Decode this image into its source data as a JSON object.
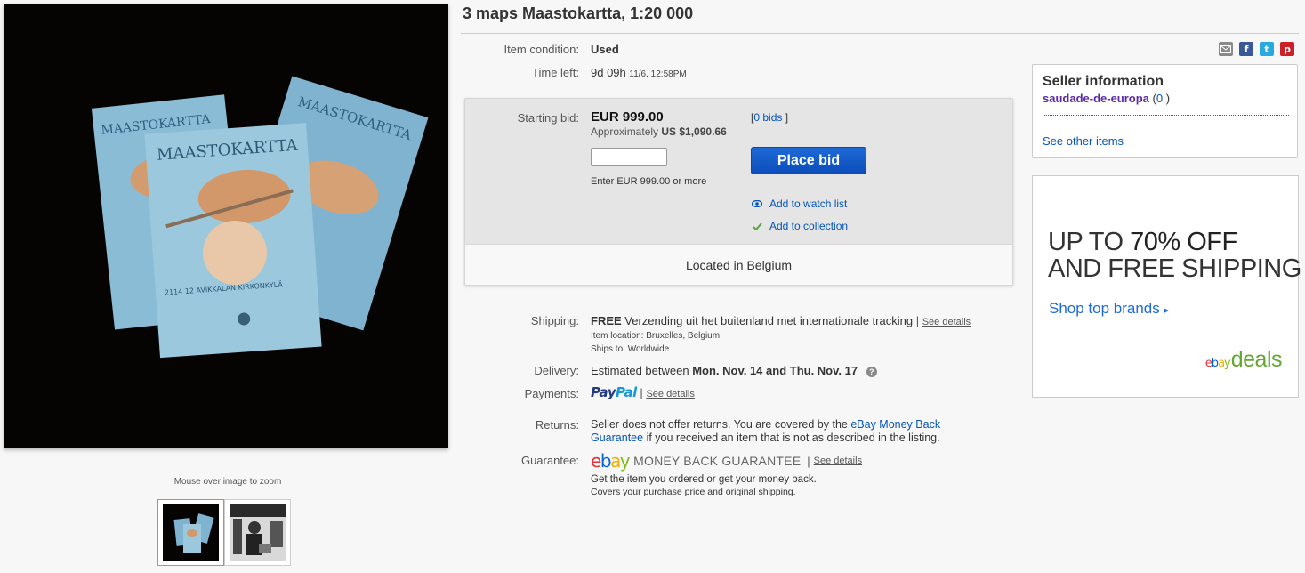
{
  "listing": {
    "title": "3 maps Maastokartta, 1:20 000"
  },
  "gallery": {
    "zoom_hint": "Mouse over image to zoom",
    "map_cover_title": "MAASTOKARTTA",
    "map_cover_footer": "2114 12 AVIKKALAN KIRKONKYLÄ"
  },
  "share": {
    "mail_icon": "mail-icon",
    "facebook_icon": "f",
    "twitter_icon": "t",
    "pinterest_icon": "p"
  },
  "details": {
    "condition_label": "Item condition:",
    "condition_value": "Used",
    "time_left_label": "Time left:",
    "time_left_value": "9d 09h",
    "time_left_end": "11/6, 12:58PM"
  },
  "bid": {
    "starting_bid_label": "Starting bid:",
    "price": "EUR 999.00",
    "approx_label": "Approximately",
    "approx_value": "US $1,090.66",
    "bids_open": "[",
    "bids_link": "0 bids",
    "bids_close": "]",
    "input_hint": "Enter EUR 999.00 or more",
    "place_bid_label": "Place bid",
    "watch_label": "Add to watch list",
    "collection_label": "Add to collection",
    "location": "Located in Belgium"
  },
  "shipping": {
    "label": "Shipping:",
    "free": "FREE",
    "method": "Verzending uit het buitenland met internationale tracking",
    "sep": "|",
    "see_details": "See details",
    "item_location": "Item location:  Bruxelles, Belgium",
    "ships_to": "Ships to:  Worldwide"
  },
  "delivery": {
    "label": "Delivery:",
    "prefix": "Estimated between",
    "dates": "Mon. Nov. 14 and Thu. Nov. 17",
    "help": "?"
  },
  "payments": {
    "label": "Payments:",
    "paypal_a": "Pay",
    "paypal_b": "Pal",
    "sep": "|",
    "see_details": "See details"
  },
  "returns": {
    "label": "Returns:",
    "text_a": "Seller does not offer returns. You are covered by the",
    "link_a": "eBay Money Back",
    "link_b": "Guarantee",
    "text_b": "if you received an item that is not as described in the listing."
  },
  "guarantee": {
    "label": "Guarantee:",
    "logo_e": "e",
    "logo_b": "b",
    "logo_a": "a",
    "logo_y": "y",
    "mbg": "MONEY BACK GUARANTEE",
    "sep": "|",
    "see_details": "See details",
    "line1": "Get the item you ordered or get your money back.",
    "line2": "Covers your purchase price and original shipping."
  },
  "seller": {
    "title": "Seller information",
    "name": "saudade-de-europa",
    "score_open": "(",
    "score": "0",
    "score_close": ")",
    "see_other": "See other items"
  },
  "ad": {
    "line1_a": "UP TO ",
    "line1_b": "70% OFF",
    "line2": "AND FREE SHIPPING",
    "cta": "Shop top brands",
    "cta_arrow": "▸",
    "brand_e": "e",
    "brand_b": "b",
    "brand_a": "a",
    "brand_y": "y",
    "brand_deals": "deals"
  },
  "colors": {
    "link": "#0654ba",
    "seller_name": "#5d2aa4",
    "button": "#0b4dbb",
    "deals_green": "#63a830"
  }
}
